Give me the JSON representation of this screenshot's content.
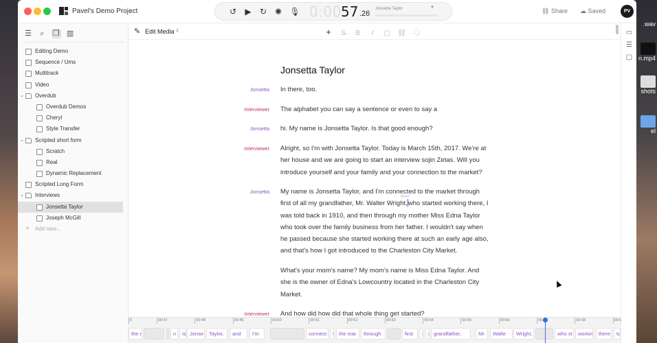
{
  "window": {
    "project_name": "Pavel's Demo Project",
    "share_label": "Share",
    "saved_label": "Saved",
    "avatar_initials": "PV"
  },
  "transport": {
    "time_dim": "0:00",
    "time_main": "57",
    "time_frac": ".26",
    "track_title": "Jonsetta Taylor"
  },
  "desktop": {
    "files": [
      ".wav",
      "n.mp4",
      "shots",
      "el"
    ]
  },
  "sidebar": {
    "items": [
      {
        "label": "Editing Demo",
        "level": 0,
        "type": "doc"
      },
      {
        "label": "Sequence / Ums",
        "level": 0,
        "type": "doc"
      },
      {
        "label": "Multitrack",
        "level": 0,
        "type": "doc"
      },
      {
        "label": "Video",
        "level": 0,
        "type": "doc"
      },
      {
        "label": "Overdub",
        "level": 0,
        "type": "folder",
        "expanded": true
      },
      {
        "label": "Overdub Demos",
        "level": 1,
        "type": "doc"
      },
      {
        "label": "Cheryl",
        "level": 1,
        "type": "doc"
      },
      {
        "label": "Style Transfer",
        "level": 1,
        "type": "doc"
      },
      {
        "label": "Scripted short form",
        "level": 0,
        "type": "folder",
        "expanded": true
      },
      {
        "label": "Scratch",
        "level": 1,
        "type": "doc"
      },
      {
        "label": "Real",
        "level": 1,
        "type": "doc"
      },
      {
        "label": "Dynamic Replacement",
        "level": 1,
        "type": "doc"
      },
      {
        "label": "Scripted Long Form",
        "level": 0,
        "type": "doc"
      },
      {
        "label": "Interviews",
        "level": 0,
        "type": "folder",
        "expanded": true
      },
      {
        "label": "Jonsetta Taylor",
        "level": 1,
        "type": "doc",
        "selected": true
      },
      {
        "label": "Joseph McGill",
        "level": 1,
        "type": "doc"
      }
    ],
    "add_new_label": "Add new..."
  },
  "editor": {
    "mode_label": "Edit Media",
    "title": "Jonsetta Taylor",
    "cursor_timestamp": "00:47",
    "paragraphs": [
      {
        "speaker": "Jonsetta",
        "text": "In there, too."
      },
      {
        "speaker": "Interviewer",
        "text": "The alphabet you can say a sentence or even to say a"
      },
      {
        "speaker": "Jonsetta",
        "text": "hi. My name is Jonsetta Taylor. Is that good enough?"
      },
      {
        "speaker": "Interviewer",
        "text": "Alright, so I'm with Jonsetta Taylor. Today is March 15th, 2017. We're at her house and we are going to start an interview sojin Zetas. Will you introduce yourself and your family and your connection to the market?"
      },
      {
        "speaker": "Jonsetta",
        "text_before_cursor": "My name is Jonsetta Taylor, and I'm connected to the market through first of all my grandfather, Mr. Walter Wright,",
        "text_after_cursor": "who started working there, I was told back in 1910, and then through my mother Miss Edna Taylor who took over the family business from her father.  I wouldn't say when he passed because she started working there at such an early age also, and that's how I got introduced to the Charleston City Market."
      },
      {
        "speaker": "",
        "text": "What's your mom's name? My mom's name is Miss Edna Taylor. And she is the owner of Edna's Lowcountry located in the Charleston City Market."
      },
      {
        "speaker": "Interviewer",
        "text": "And how did how did that whole thing get started?"
      }
    ]
  },
  "timeline": {
    "ticks": [
      "6",
      "00:47",
      "00:48",
      "00:49",
      "00:50",
      "00:51",
      "00:52",
      "00:53",
      "00:54",
      "00:55",
      "00:56",
      "00:57",
      "00:58",
      "00:5"
    ],
    "words": [
      "the r",
      "",
      "",
      "n",
      "is",
      "Jonse",
      "Taylor,",
      "and",
      "I'm",
      "",
      "connect",
      "t",
      "the mar",
      "through",
      "",
      "first",
      "a",
      "r",
      "grandfather,",
      "Mr.",
      "Walte",
      "Wright,",
      "",
      "who st",
      "workin",
      "there",
      "to"
    ]
  },
  "colors": {
    "speaker_jonsetta": "#8d53c4",
    "speaker_interviewer": "#c2305a",
    "playhead": "#3a6fe0"
  }
}
